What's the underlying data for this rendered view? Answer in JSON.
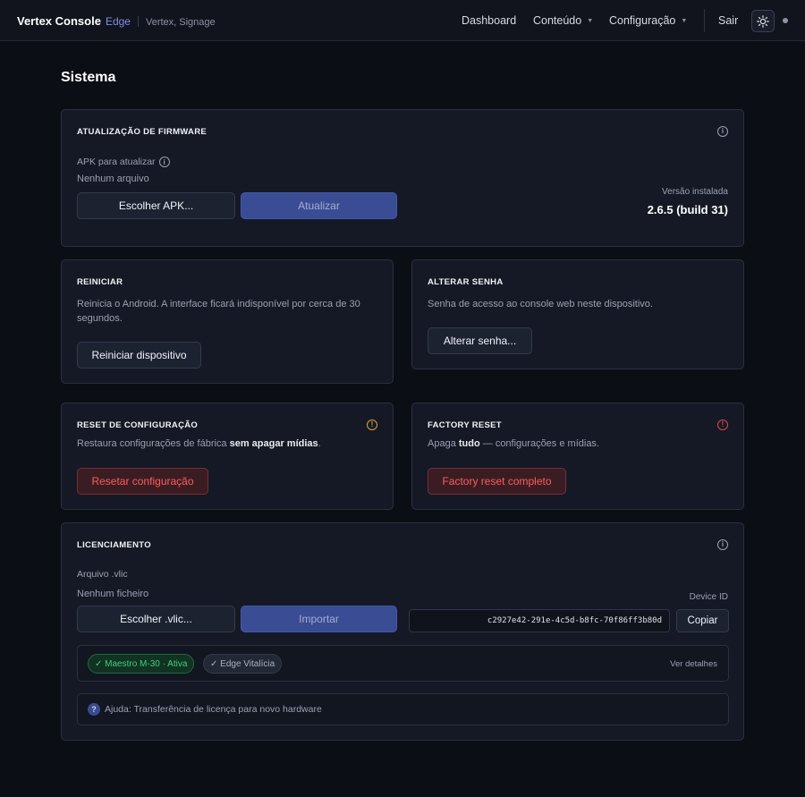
{
  "header": {
    "brand": "Vertex Console",
    "brand_edition": "Edge",
    "brand_subtitle": "Vertex, Signage",
    "nav": {
      "dashboard": "Dashboard",
      "content": "Conteúdo",
      "settings": "Configuração",
      "logout": "Sair"
    },
    "icons": {
      "theme": "sun-icon",
      "status": "status-dot"
    }
  },
  "page": {
    "title": "Sistema"
  },
  "firmware": {
    "title": "ATUALIZAÇÃO DE FIRMWARE",
    "apk_label": "APK para atualizar",
    "file_status": "Nenhum arquivo",
    "choose_button": "Escolher APK...",
    "update_button": "Atualizar",
    "installed_label": "Versão instalada",
    "installed_version": "2.6.5 (build 31)"
  },
  "restart": {
    "title": "REINICIAR",
    "description": "Reinicia o Android. A interface ficará indisponível por cerca de 30 segundos.",
    "button": "Reiniciar dispositivo"
  },
  "password": {
    "title": "ALTERAR SENHA",
    "description": "Senha de acesso ao console web neste dispositivo.",
    "button": "Alterar senha..."
  },
  "config_reset": {
    "title": "RESET DE CONFIGURAÇÃO",
    "description_prefix": "Restaura configurações de fábrica ",
    "description_bold": "sem apagar mídias",
    "description_suffix": ".",
    "button": "Resetar configuração"
  },
  "factory_reset": {
    "title": "FACTORY RESET",
    "description_prefix": "Apaga ",
    "description_bold": "tudo",
    "description_suffix": " — configurações e mídias.",
    "button": "Factory reset completo"
  },
  "licensing": {
    "title": "LICENCIAMENTO",
    "file_label": "Arquivo .vlic",
    "file_status": "Nenhum ficheiro",
    "choose_button": "Escolher .vlic...",
    "import_button": "Importar",
    "device_id_label": "Device ID",
    "device_id": "c2927e42-291e-4c5d-b8fc-70f86ff3b80d",
    "copy_button": "Copiar",
    "badges": [
      "✓ Maestro M-30 · Ativa",
      "✓ Edge Vitalícia"
    ],
    "details_link": "Ver detalhes",
    "help_icon": "?",
    "help_text": "Ajuda: Transferência de licença para novo hardware"
  },
  "colors": {
    "background": "#0c0e15",
    "card": "#151925",
    "accent": "#3a4c94",
    "danger": "#ff5c5c",
    "warning": "#e0a03a",
    "success": "#3fcf7a"
  }
}
